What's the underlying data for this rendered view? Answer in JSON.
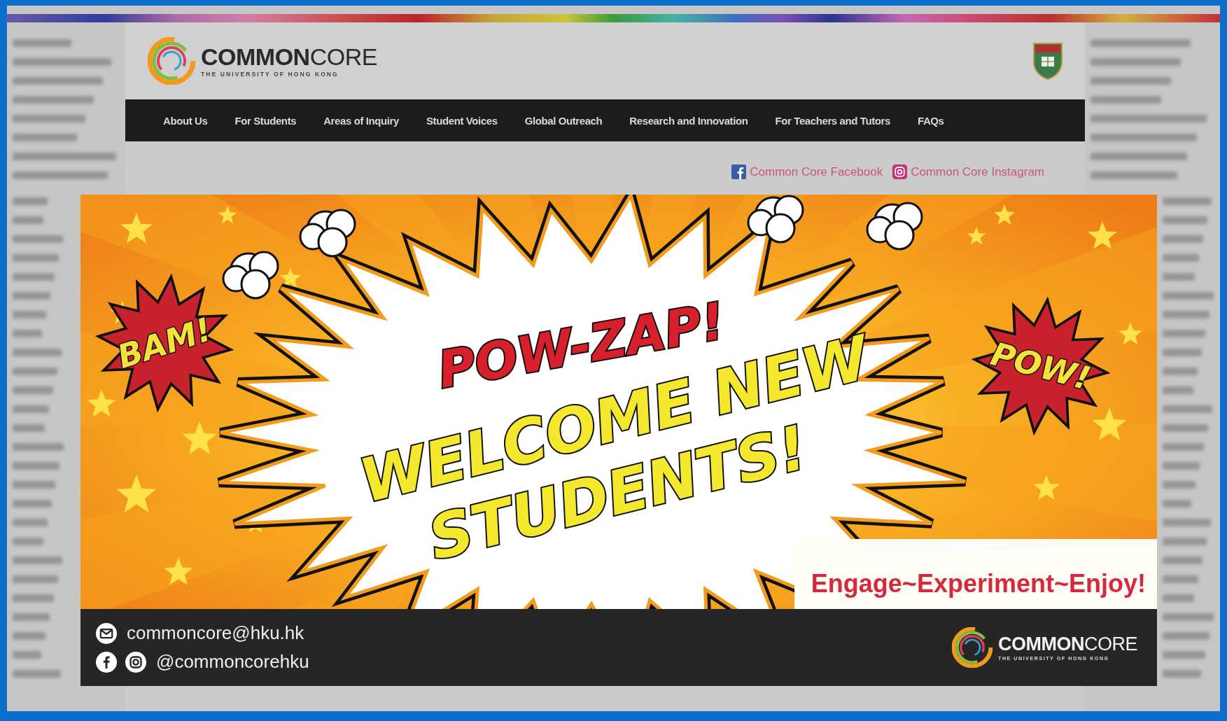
{
  "header": {
    "logo": {
      "title": "**COMMON**CORE",
      "subtitle": "THE UNIVERSITY OF HONG KONG"
    }
  },
  "nav": [
    "About Us",
    "For Students",
    "Areas of Inquiry",
    "Student Voices",
    "Global Outreach",
    "Research and Innovation",
    "For Teachers and Tutors",
    "FAQs"
  ],
  "social_links": [
    {
      "kind": "facebook",
      "label": "Common Core Facebook"
    },
    {
      "kind": "instagram",
      "label": "Common Core Instagram"
    }
  ],
  "banner": {
    "exclamations": [
      "BAM!",
      "POW!"
    ],
    "headline": "POW-ZAP!",
    "title_lines": [
      "WELCOME NEW",
      "STUDENTS!"
    ],
    "tagline": "Engage~Experiment~Enjoy!",
    "contacts": [
      {
        "kind": "email",
        "text": "commoncore@hku.hk"
      },
      {
        "kind": "social_handle",
        "text": "@commoncorehku"
      }
    ],
    "logo": {
      "title": "**COMMON**CORE",
      "subtitle": "THE UNIVERSITY OF HONG KONG"
    }
  }
}
